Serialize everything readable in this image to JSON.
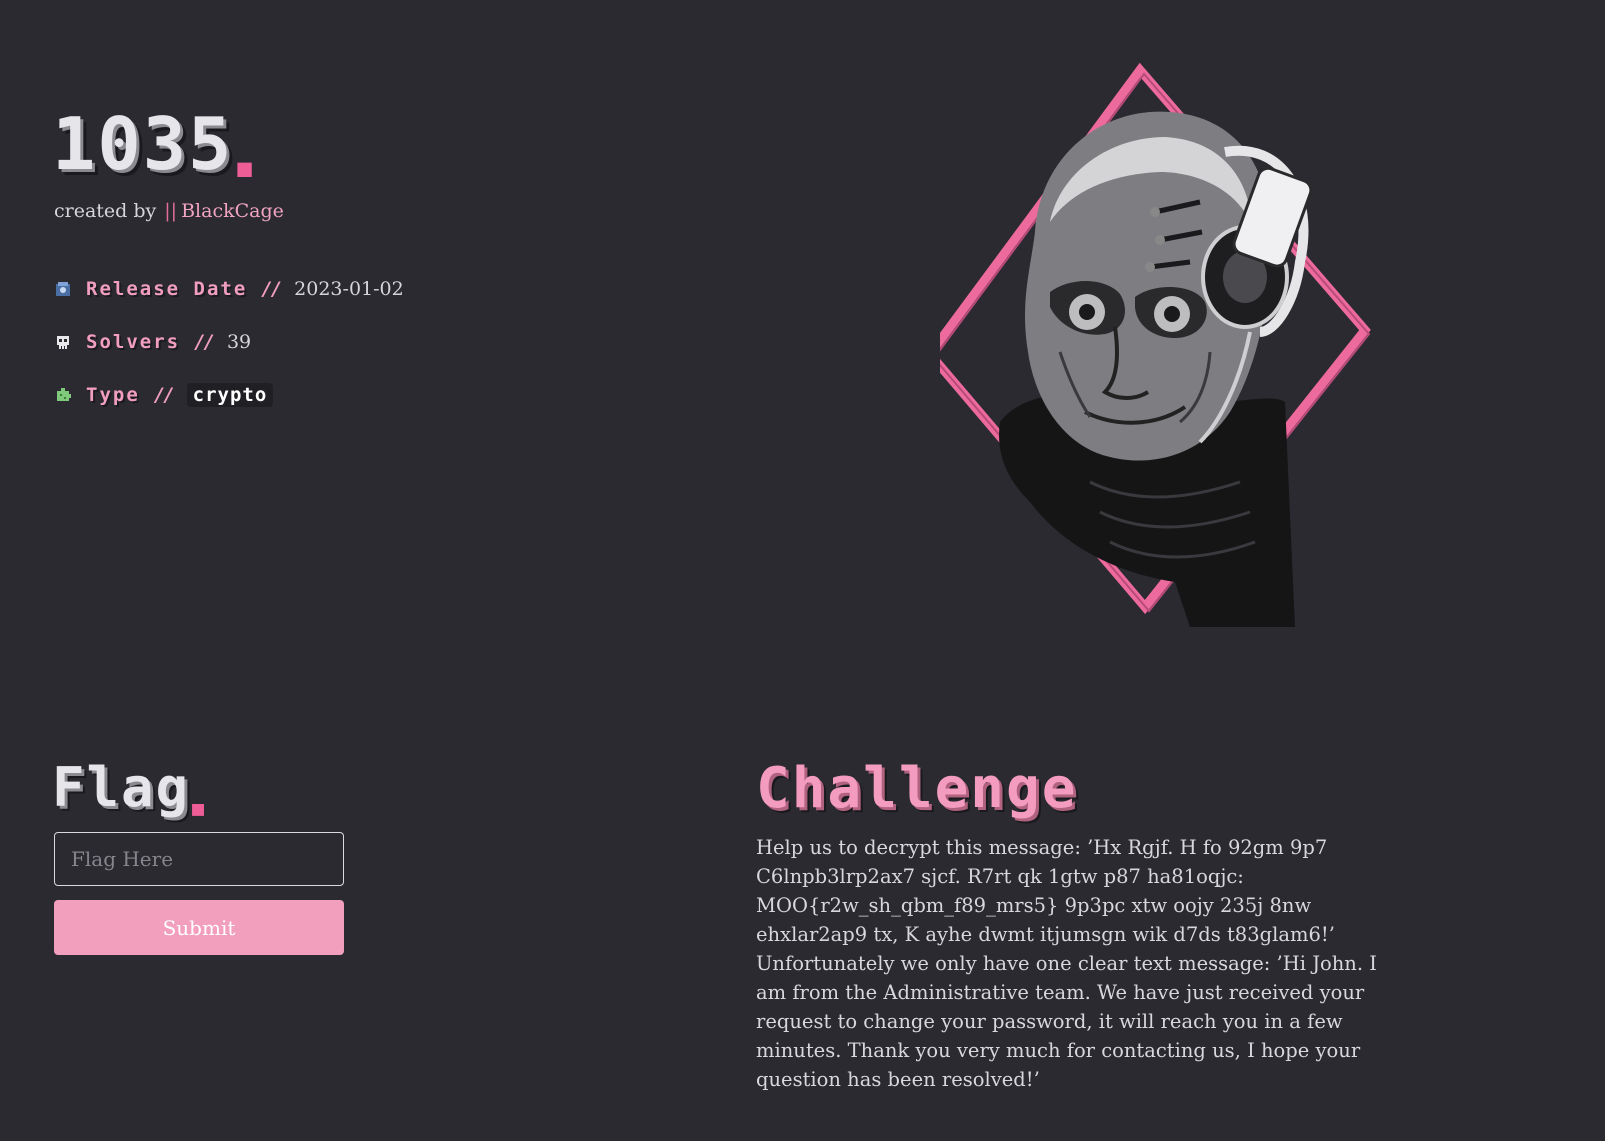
{
  "challenge": {
    "id": "1035",
    "created_by_label": "created by",
    "separator": "||",
    "author": "BlackCage"
  },
  "meta": {
    "release_label": "Release Date",
    "release_value": "2023-01-02",
    "solvers_label": "Solvers",
    "solvers_value": "39",
    "type_label": "Type",
    "type_value": "crypto",
    "divider": "//"
  },
  "flag": {
    "title": "Flag",
    "placeholder": "Flag Here",
    "submit_label": "Submit"
  },
  "description": {
    "title": "Challenge",
    "text": "Help us to decrypt this message: ’Hx Rgjf. H fo 92gm 9p7 C6lnpb3lrp2ax7 sjcf. R7rt qk 1gtw p87 ha81oqjc: MOO{r2w_sh_qbm_f89_mrs5} 9p3pc xtw oojy 235j 8nw ehxlar2ap9 tx, K ayhe dwmt itjumsgn wik d7ds t83glam6!’ Unfortunately we only have one clear text message: ’Hi John. I am from the Administrative team. We have just received your request to change your password, it will reach you in a few minutes. Thank you very much for contacting us, I hope your question has been resolved!’"
  },
  "colors": {
    "background": "#2b2a30",
    "accent_pink": "#f29fbe",
    "accent_magenta": "#ee5d96"
  },
  "icons": {
    "release": "badge-icon",
    "solvers": "skull-icon",
    "type": "puzzle-icon"
  }
}
